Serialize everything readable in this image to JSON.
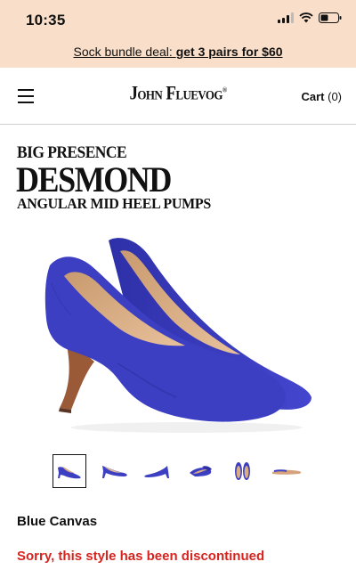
{
  "status_bar": {
    "time": "10:35",
    "icons": [
      "signal-icon",
      "wifi-icon",
      "battery-icon"
    ]
  },
  "promo": {
    "text": "Sock bundle deal: ",
    "bold": "get 3 pairs for $60"
  },
  "header": {
    "logo": "John Fluevog",
    "cart_label": "Cart",
    "cart_count": "(0)"
  },
  "product": {
    "eyebrow": "BIG PRESENCE",
    "name": "DESMOND",
    "subtitle": "ANGULAR MID HEEL PUMPS",
    "image_alt": "blue pointed-toe mid heel pumps",
    "thumbnails": [
      "thumb-1",
      "thumb-2",
      "thumb-3",
      "thumb-4",
      "thumb-5",
      "thumb-6"
    ],
    "selected_thumbnail": 1,
    "color": "Blue Canvas",
    "availability": "Sorry, this style has been discontinued"
  },
  "colors": {
    "promo_background": "#f9dfc9",
    "shoe_blue": "#3d3fc2",
    "alert_red": "#d8241f"
  }
}
